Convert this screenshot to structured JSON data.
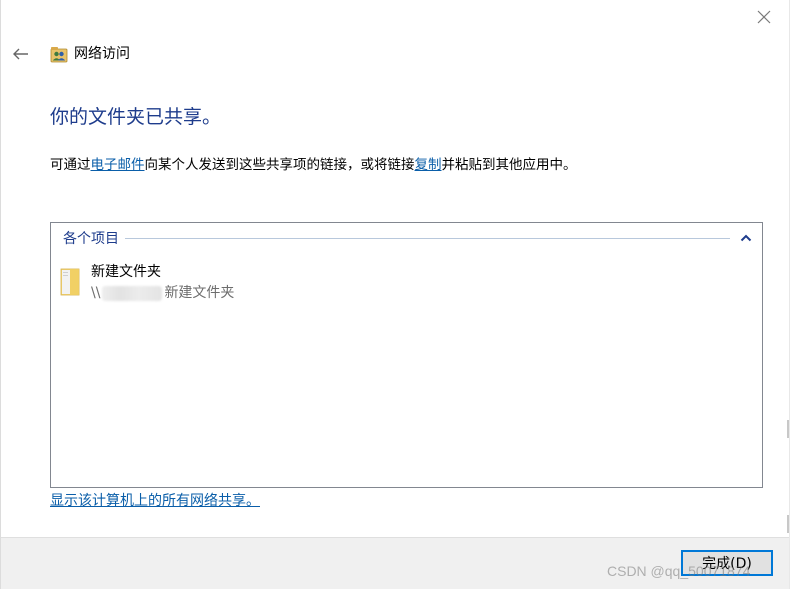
{
  "window": {
    "title": "网络访问",
    "close_icon": "close-icon",
    "back_icon": "back-arrow-icon",
    "title_icon": "network-users-icon"
  },
  "headline": "你的文件夹已共享。",
  "description": {
    "part1": "可通过",
    "link_email": "电子邮件",
    "part2": "向某个人发送到这些共享项的链接，或将链接",
    "link_copy": "复制",
    "part3": "并粘贴到其他应用中。"
  },
  "items_group": {
    "label": "各个项目",
    "collapse_icon": "chevron-up-icon",
    "items": [
      {
        "name": "新建文件夹",
        "path_prefix": "\\\\",
        "path_suffix": "新建文件夹",
        "icon": "folder-icon"
      }
    ]
  },
  "show_all_link": "显示该计算机上的所有网络共享。",
  "footer": {
    "finish_label": "完成(D)"
  },
  "watermark": "CSDN @qq_50071874",
  "colors": {
    "headline": "#1e3c8c",
    "link": "#0a5ea9",
    "button_focus_border": "#0078d7",
    "footer_bg": "#f0f0f0"
  }
}
